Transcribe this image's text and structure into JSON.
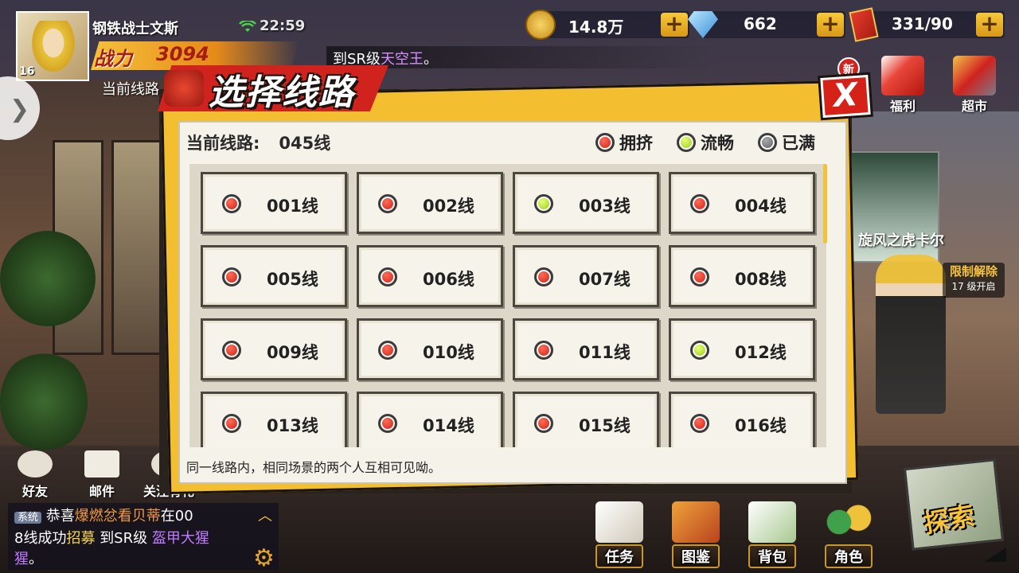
{
  "player": {
    "name": "钢铁战士文斯",
    "level": "16",
    "time": "22:59",
    "power_label": "战力",
    "power_value": "3094",
    "current_line_label": "当前线路"
  },
  "currencies": [
    {
      "icon": "coin-icon",
      "value": "14.8万"
    },
    {
      "icon": "diamond-icon",
      "value": "662"
    },
    {
      "icon": "ticket-icon",
      "value": "331/90"
    }
  ],
  "broadcast": {
    "prefix": "到SR级",
    "highlight": "天空王",
    "suffix": "。"
  },
  "top_icons": [
    {
      "name": "welfare",
      "label": "福利"
    },
    {
      "name": "supermarket",
      "label": "超市"
    }
  ],
  "new_badge": "新",
  "banner": {
    "character_name": "旋风之虎卡尔",
    "limit_title": "限制解除",
    "limit_sub": "17 级开启"
  },
  "dialog": {
    "title": "选择线路",
    "close_label": "X",
    "current_line_label": "当前线路:",
    "current_line_value": "045线",
    "legend": [
      {
        "status": "red",
        "label": "拥挤"
      },
      {
        "status": "green",
        "label": "流畅"
      },
      {
        "status": "grey",
        "label": "已满"
      }
    ],
    "lines": [
      {
        "label": "001线",
        "status": "red"
      },
      {
        "label": "002线",
        "status": "red"
      },
      {
        "label": "003线",
        "status": "green"
      },
      {
        "label": "004线",
        "status": "red"
      },
      {
        "label": "005线",
        "status": "red"
      },
      {
        "label": "006线",
        "status": "red"
      },
      {
        "label": "007线",
        "status": "red"
      },
      {
        "label": "008线",
        "status": "red"
      },
      {
        "label": "009线",
        "status": "red"
      },
      {
        "label": "010线",
        "status": "red"
      },
      {
        "label": "011线",
        "status": "red"
      },
      {
        "label": "012线",
        "status": "green"
      },
      {
        "label": "013线",
        "status": "red"
      },
      {
        "label": "014线",
        "status": "red"
      },
      {
        "label": "015线",
        "status": "red"
      },
      {
        "label": "016线",
        "status": "red"
      }
    ],
    "footer_tip": "同一线路内，相同场景的两个人互相可见呦。"
  },
  "social": [
    {
      "name": "friends",
      "label": "好友"
    },
    {
      "name": "mail",
      "label": "邮件"
    },
    {
      "name": "follow",
      "label": "关注有礼"
    }
  ],
  "chat": {
    "tag": "系统",
    "line1_a": "恭喜",
    "line1_b": "爆燃忿看贝蒂",
    "line1_c": "在00",
    "line2_a": "8线成功",
    "line2_b": "招募",
    "line2_c": "到SR级",
    "line2_d": "盔甲大猩",
    "line3_a": "猩",
    "line3_b": "。"
  },
  "bottom_menu": [
    {
      "name": "tasks",
      "label": "任务"
    },
    {
      "name": "handbook",
      "label": "图鉴"
    },
    {
      "name": "backpack",
      "label": "背包"
    },
    {
      "name": "characters",
      "label": "角色"
    }
  ],
  "explore_label": "探索",
  "colors": {
    "accent": "#f3be2f",
    "danger": "#d0231e",
    "status_red": "#c1180e",
    "status_green": "#8cc21a",
    "status_grey": "#555555"
  }
}
